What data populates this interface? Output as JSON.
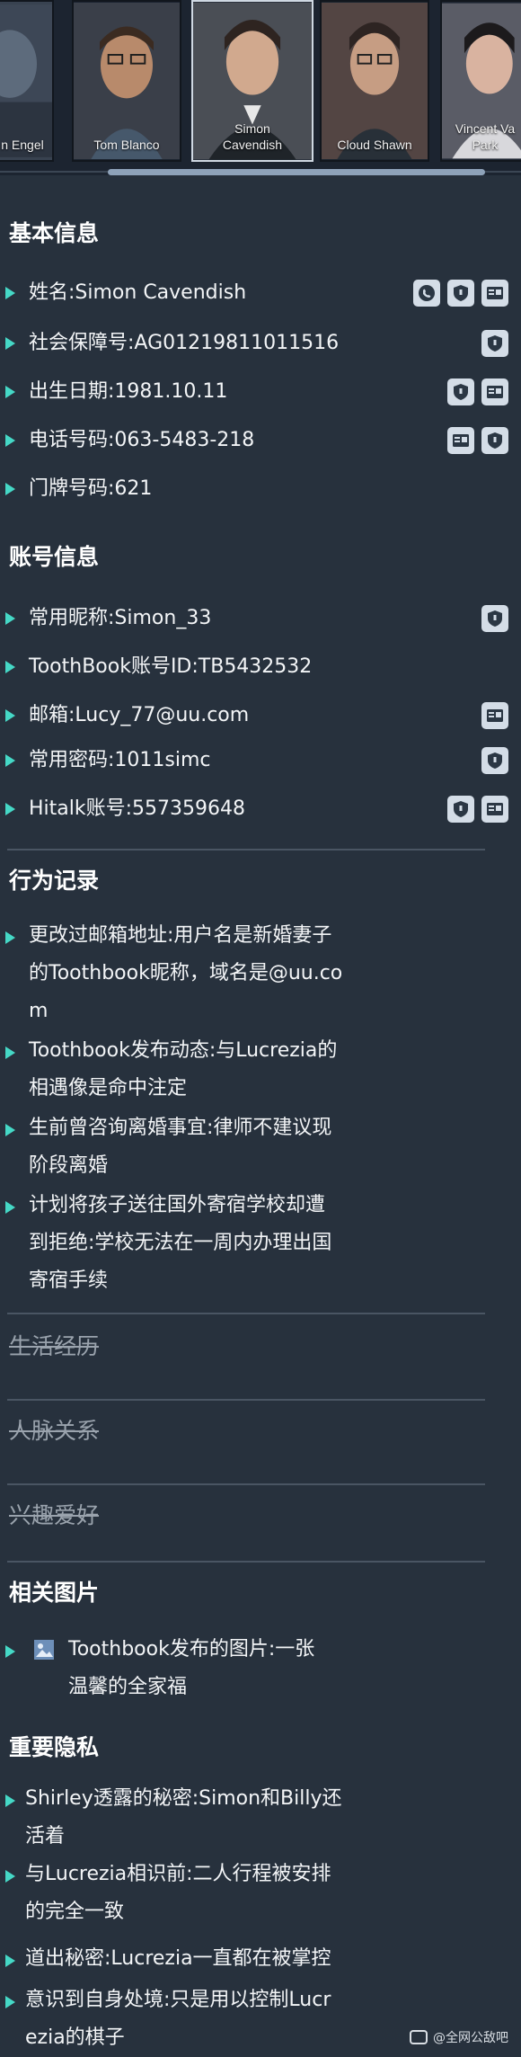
{
  "portraits": [
    {
      "name": "n Engel"
    },
    {
      "name": "Tom Blanco"
    },
    {
      "name": "Simon\nCavendish",
      "active": true
    },
    {
      "name": "Cloud Shawn"
    },
    {
      "name": "Vincent Va\nPark"
    }
  ],
  "basic": {
    "title": "基本信息",
    "rows": [
      {
        "text": "姓名:Simon Cavendish",
        "icons": [
          "phone-icon",
          "shield-icon",
          "id-card-icon"
        ]
      },
      {
        "text": "社会保障号:AG01219811011516",
        "icons": [
          "shield-icon"
        ]
      },
      {
        "text": "出生日期:1981.10.11",
        "icons": [
          "shield-icon",
          "id-card-icon"
        ]
      },
      {
        "text": "电话号码:063-5483-218",
        "icons": [
          "id-card-icon",
          "shield-icon"
        ]
      },
      {
        "text": "门牌号码:621",
        "icons": []
      }
    ]
  },
  "account": {
    "title": "账号信息",
    "rows": [
      {
        "text": "常用昵称:Simon_33",
        "icons": [
          "shield-icon"
        ]
      },
      {
        "text": "ToothBook账号ID:TB5432532",
        "icons": []
      },
      {
        "text": "邮箱:Lucy_77@uu.com",
        "icons": [
          "id-card-icon"
        ]
      },
      {
        "text": "常用密码:1011simc",
        "icons": [
          "shield-icon"
        ]
      },
      {
        "text": "Hitalk账号:557359648",
        "icons": [
          "shield-icon",
          "id-card-icon"
        ]
      }
    ]
  },
  "behavior": {
    "title": "行为记录",
    "items": [
      {
        "lines": [
          "更改过邮箱地址:用户名是新婚妻子",
          "的Toothbook昵称，域名是@uu.co",
          "m"
        ]
      },
      {
        "lines": [
          "Toothbook发布动态:与Lucrezia的",
          "相遇像是命中注定"
        ]
      },
      {
        "lines": [
          "生前曾咨询离婚事宜:律师不建议现",
          "阶段离婚"
        ]
      },
      {
        "lines": [
          "计划将孩子送往国外寄宿学校却遭",
          "到拒绝:学校无法在一周内办理出国",
          "寄宿手续"
        ]
      }
    ]
  },
  "locked": {
    "life": "生活经历",
    "relations": "人脉关系",
    "hobbies": "兴趣爱好"
  },
  "pictures": {
    "title": "相关图片",
    "items": [
      {
        "lines": [
          "Toothbook发布的图片:一张",
          "温馨的全家福"
        ]
      }
    ]
  },
  "privacy": {
    "title": "重要隐私",
    "items": [
      {
        "lines": [
          "Shirley透露的秘密:Simon和Billy还",
          "活着"
        ]
      },
      {
        "lines": [
          "与Lucrezia相识前:二人行程被安排",
          "的完全一致"
        ]
      },
      {
        "lines": [
          "道出秘密:Lucrezia一直都在被掌控"
        ]
      },
      {
        "lines": [
          "意识到自身处境:只是用以控制Lucr",
          "ezia的棋子"
        ]
      }
    ]
  },
  "watermark": "@全网公敌吧",
  "colors": {
    "accent": "#45d8c6",
    "background": "#27313d"
  }
}
